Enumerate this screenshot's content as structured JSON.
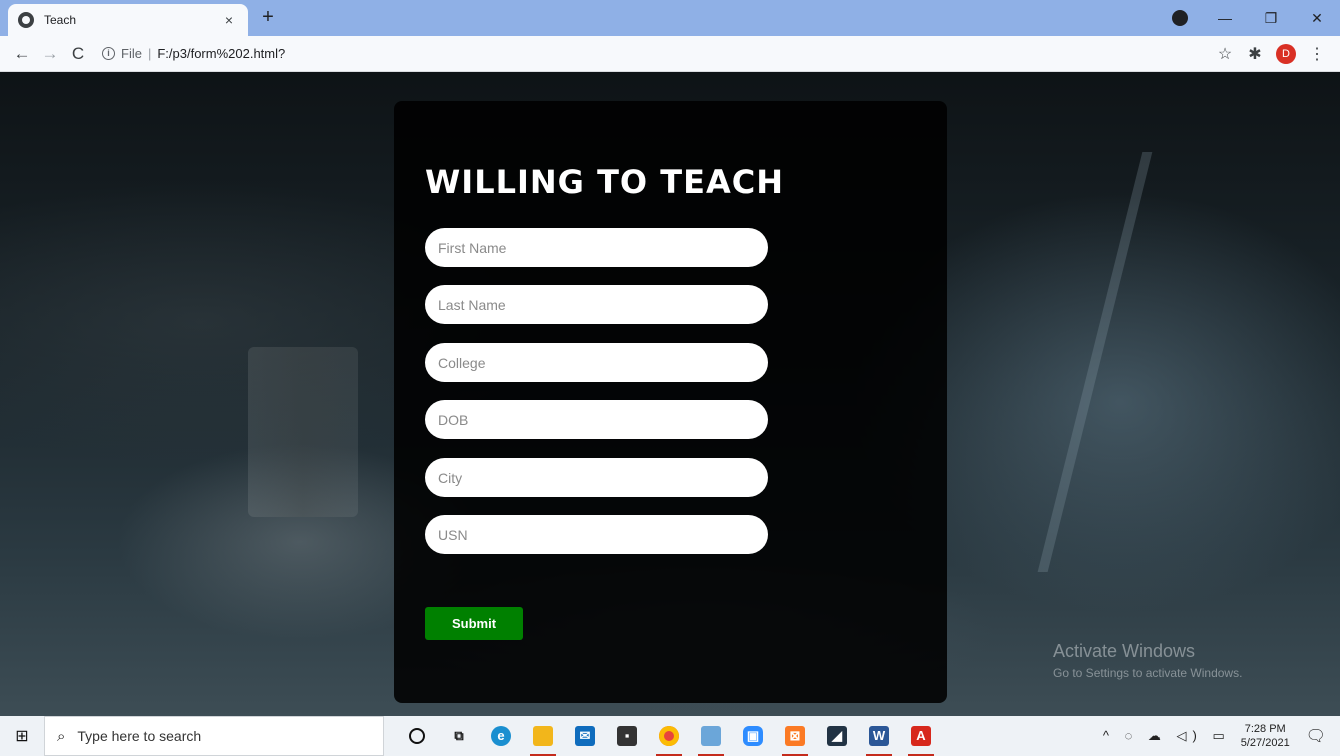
{
  "browser": {
    "tab_title": "Teach",
    "tab_close": "×",
    "new_tab": "+",
    "url_info": "i",
    "url_scheme": "File",
    "url_separator": "|",
    "url": "F:/p3/form%202.html?",
    "profile_initial": "D",
    "icons": {
      "back": "←",
      "forward": "→",
      "reload": "C",
      "star": "☆",
      "extensions": "✱",
      "menu": "⋮",
      "minimize": "—",
      "restore": "❐",
      "close": "✕"
    }
  },
  "page": {
    "title": "WILLING TO TEACH",
    "fields": {
      "first_name": "First Name",
      "last_name": "Last Name",
      "college": "College",
      "dob": "DOB",
      "city": "City",
      "usn": "USN"
    },
    "submit_label": "Submit"
  },
  "watermark": {
    "line1": "Activate Windows",
    "line2": "Go to Settings to activate Windows."
  },
  "taskbar": {
    "search_placeholder": "Type here to search",
    "time": "7:28 PM",
    "date": "5/27/2021",
    "tray_icons": "^ ◌ ☁ ◁) ▭",
    "apps": [
      "cortana",
      "task-view",
      "edge",
      "file-explorer",
      "mail",
      "store",
      "chrome",
      "app-7",
      "zoom",
      "xampp",
      "app-11",
      "word",
      "acrobat"
    ]
  }
}
